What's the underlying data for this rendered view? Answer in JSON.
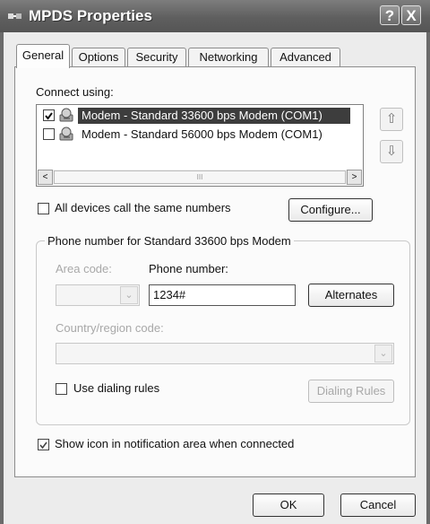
{
  "window": {
    "title": "MPDS Properties",
    "help_glyph": "?",
    "close_glyph": "X"
  },
  "tabs": [
    {
      "label": "General",
      "active": true
    },
    {
      "label": "Options"
    },
    {
      "label": "Security"
    },
    {
      "label": "Networking"
    },
    {
      "label": "Advanced"
    }
  ],
  "connect_using": {
    "label": "Connect using:",
    "items": [
      {
        "label": "Modem - Standard 33600 bps Modem (COM1)",
        "checked": true,
        "selected": true
      },
      {
        "label": "Modem - Standard 56000 bps Modem (COM1)",
        "checked": false,
        "selected": false
      }
    ],
    "scroll_left": "<",
    "scroll_right": ">",
    "scroll_thumb_grip": "III",
    "move_up_icon": "⇧",
    "move_down_icon": "⇩"
  },
  "all_devices": {
    "label": "All devices call the same numbers",
    "checked": false
  },
  "configure_button": "Configure...",
  "phone_group": {
    "title": "Phone number for Standard 33600 bps Modem",
    "area_code_label": "Area code:",
    "phone_number_label": "Phone number:",
    "phone_number_value": "1234#",
    "alternates_button": "Alternates",
    "country_label": "Country/region code:",
    "use_dialing_rules_label": "Use dialing rules",
    "use_dialing_rules_checked": false,
    "dialing_rules_button": "Dialing Rules"
  },
  "show_icon": {
    "label": "Show icon in notification area when connected",
    "checked": true
  },
  "footer": {
    "ok": "OK",
    "cancel": "Cancel"
  }
}
